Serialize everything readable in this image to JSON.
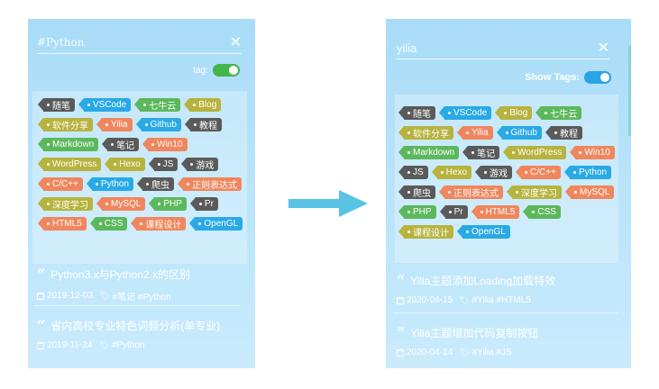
{
  "left": {
    "search_value": "#Python",
    "tags_label": "tag:",
    "tags": [
      {
        "label": "随笔",
        "color": "dark"
      },
      {
        "label": "VSCode",
        "color": "blue"
      },
      {
        "label": "七牛云",
        "color": "green"
      },
      {
        "label": "Blog",
        "color": "olive"
      },
      {
        "label": "软件分享",
        "color": "olive"
      },
      {
        "label": "Yilia",
        "color": "orange"
      },
      {
        "label": "Github",
        "color": "blue"
      },
      {
        "label": "教程",
        "color": "dark"
      },
      {
        "label": "Markdown",
        "color": "green"
      },
      {
        "label": "笔记",
        "color": "dark"
      },
      {
        "label": "Win10",
        "color": "orange"
      },
      {
        "label": "WordPress",
        "color": "olive"
      },
      {
        "label": "Hexo",
        "color": "olive"
      },
      {
        "label": "JS",
        "color": "dark"
      },
      {
        "label": "游戏",
        "color": "dark"
      },
      {
        "label": "C/C++",
        "color": "orange"
      },
      {
        "label": "Python",
        "color": "blue"
      },
      {
        "label": "爬虫",
        "color": "dark"
      },
      {
        "label": "正则表达式",
        "color": "orange"
      },
      {
        "label": "深度学习",
        "color": "olive"
      },
      {
        "label": "MySQL",
        "color": "orange"
      },
      {
        "label": "PHP",
        "color": "green"
      },
      {
        "label": "Pr",
        "color": "dark"
      },
      {
        "label": "HTML5",
        "color": "orange"
      },
      {
        "label": "CSS",
        "color": "green"
      },
      {
        "label": "课程设计",
        "color": "orange"
      },
      {
        "label": "OpenGL",
        "color": "blue"
      }
    ],
    "posts": [
      {
        "title": "Python3.x与Python2.x的区别",
        "date": "2019-12-03",
        "tags": "#笔记 #Python"
      },
      {
        "title": "省内高校专业特色词频分析(单专业)",
        "date": "2019-11-24",
        "tags": "#Python"
      }
    ]
  },
  "right": {
    "search_value": "yilia",
    "tags_label": "Show Tags:",
    "tags": [
      {
        "label": "随笔",
        "color": "dark"
      },
      {
        "label": "VSCode",
        "color": "blue"
      },
      {
        "label": "Blog",
        "color": "olive"
      },
      {
        "label": "七牛云",
        "color": "green"
      },
      {
        "label": "软件分享",
        "color": "olive"
      },
      {
        "label": "Yilia",
        "color": "orange"
      },
      {
        "label": "Github",
        "color": "blue"
      },
      {
        "label": "教程",
        "color": "dark"
      },
      {
        "label": "Markdown",
        "color": "green"
      },
      {
        "label": "笔记",
        "color": "dark"
      },
      {
        "label": "WordPress",
        "color": "olive"
      },
      {
        "label": "Win10",
        "color": "orange"
      },
      {
        "label": "JS",
        "color": "dark"
      },
      {
        "label": "Hexo",
        "color": "olive"
      },
      {
        "label": "游戏",
        "color": "dark"
      },
      {
        "label": "C/C++",
        "color": "orange"
      },
      {
        "label": "Python",
        "color": "blue"
      },
      {
        "label": "爬虫",
        "color": "dark"
      },
      {
        "label": "正则表达式",
        "color": "orange"
      },
      {
        "label": "深度学习",
        "color": "olive"
      },
      {
        "label": "MySQL",
        "color": "orange"
      },
      {
        "label": "PHP",
        "color": "green"
      },
      {
        "label": "Pr",
        "color": "dark"
      },
      {
        "label": "HTML5",
        "color": "orange"
      },
      {
        "label": "CSS",
        "color": "green"
      },
      {
        "label": "课程设计",
        "color": "olive"
      },
      {
        "label": "OpenGL",
        "color": "blue"
      }
    ],
    "posts": [
      {
        "title": "Yilia主题添加Loading加载特效",
        "date": "2020-04-15",
        "tags": "#Yilia #HTML5"
      },
      {
        "title": "Yilia主题增加代码复制按钮",
        "date": "2020-04-14",
        "tags": "#Yilia #JS"
      }
    ]
  },
  "icons": {
    "close": "close-icon",
    "quote": "quote-icon",
    "calendar": "calendar-icon",
    "tag": "tag-icon",
    "arrow": "arrow-right-icon"
  },
  "colors": {
    "dark": "#5a5a5a",
    "blue": "#29a9e6",
    "green": "#5cb85c",
    "olive": "#b7b33e",
    "orange": "#f0865d",
    "arrow": "#59c3e5"
  }
}
